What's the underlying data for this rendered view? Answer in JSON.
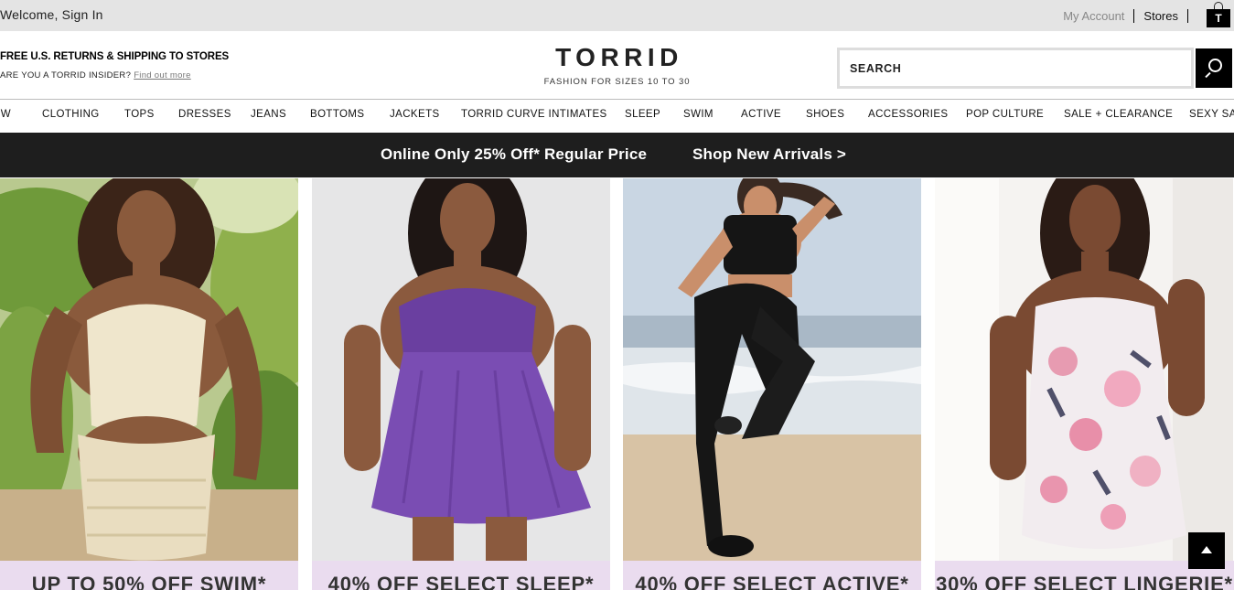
{
  "topbar": {
    "welcome": "Welcome, Sign In",
    "my_account": "My Account",
    "stores": "Stores",
    "bag_icon_letter": "T"
  },
  "header": {
    "promo_line_1": "FREE U.S. RETURNS & SHIPPING TO STORES",
    "promo_line_2": "ARE YOU A TORRID INSIDER?",
    "promo_link": "Find out more",
    "logo": "TORRID",
    "tagline": "FASHION FOR SIZES 10 TO 30",
    "search_placeholder": "SEARCH",
    "search_icon": "search-icon"
  },
  "nav": {
    "items": [
      "NEW",
      "CLOTHING",
      "TOPS",
      "DRESSES",
      "JEANS",
      "BOTTOMS",
      "JACKETS",
      "TORRID CURVE INTIMATES",
      "SLEEP",
      "SWIM",
      "ACTIVE",
      "SHOES",
      "ACCESSORIES",
      "POP CULTURE",
      "SALE + CLEARANCE",
      "SEXY SALE"
    ]
  },
  "strip": {
    "offer": "Online Only 25% Off* Regular Price",
    "cta": "Shop New Arrivals >"
  },
  "tiles": [
    {
      "caption": "UP TO 50% OFF SWIM*"
    },
    {
      "caption": "40% OFF SELECT SLEEP*"
    },
    {
      "caption": "40% OFF SELECT ACTIVE*"
    },
    {
      "caption": "30% OFF SELECT LINGERIE*"
    }
  ],
  "colors": {
    "topbar_bg": "#e4e4e4",
    "strip_bg": "#1e1e1e",
    "caption_bg": "#eadcef",
    "accent_purple": "#6a3fa0"
  }
}
